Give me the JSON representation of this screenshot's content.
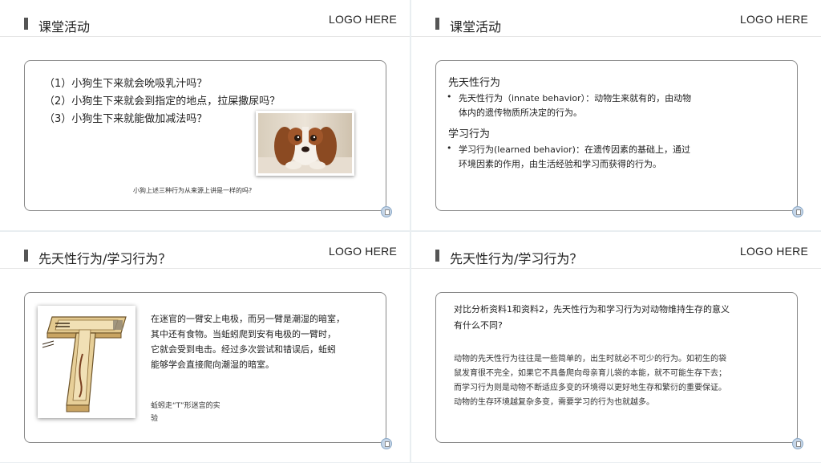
{
  "logo": "LOGO HERE",
  "slide1": {
    "title": "课堂活动",
    "questions": [
      "（1）小狗生下来就会吮吸乳汁吗？",
      "（2）小狗生下来就会到指定的地点，拉屎撒尿吗？",
      "（3）小狗生下来就能做加减法吗？"
    ],
    "caption": "小狗上述三种行为从来源上讲是一样的吗?"
  },
  "slide2": {
    "title": "课堂活动",
    "innate_heading": "先天性行为",
    "innate_lines": [
      "先天性行为（innate behavior）：动物生来就有的，由动物",
      "体内的遗传物质所决定的行为。"
    ],
    "learned_heading": "学习行为",
    "learned_lines": [
      "学习行为(learned  behavior)：在遗传因素的基础上，通过",
      "环境因素的作用，由生活经验和学习而获得的行为。"
    ],
    "bullet": "•"
  },
  "slide3": {
    "title": "先天性行为/学习行为？",
    "paragraph": [
      "在迷官的一臂安上电极，而另一臂是潮湿的暗室，",
      "其中还有食物。当蚯蚓爬到安有电极的一臂时，",
      "它就会受到电击。经过多次尝试和错误后，蚯蚓",
      "能够学会直接爬向潮湿的暗室。"
    ],
    "caption": [
      "蚯蚓走“T”形迷宫的实",
      "验"
    ]
  },
  "slide4": {
    "title": "先天性行为/学习行为？",
    "question": [
      "对比分析资料1和资料2，先天性行为和学习行为对动物维持生存的意义",
      "有什么不同?"
    ],
    "answer": [
      "动物的先天性行为往往是一些简单的，出生时就必不可少的行为。如初生的袋",
      "鼠发育很不完全，如果它不具备爬向母亲育儿袋的本能，就不可能生存下去；",
      "而学习行为则是动物不断适应多变的环境得以更好地生存和繁衍的重要保证。",
      "动物的生存环境越复杂多变，需要学习的行为也就越多。"
    ]
  },
  "icons": {
    "title_marker": "vertical-bar",
    "corner_badge": "presentation-badge-icon",
    "dog_photo": "dog-photo",
    "maze_image": "t-maze-illustration"
  },
  "colors": {
    "background": "#e9eef1",
    "slide": "#ffffff",
    "border": "#888888",
    "badge": "#c6d6e8"
  }
}
